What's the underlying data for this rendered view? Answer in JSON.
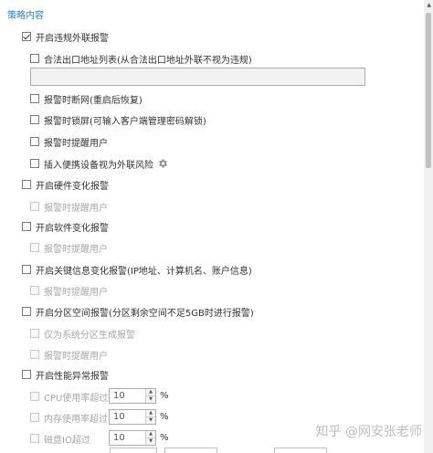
{
  "section": {
    "title": "策略内容"
  },
  "items": [
    {
      "key": "violation_alert",
      "label": "开启违规外联报警",
      "checked": true,
      "disabled": false
    },
    {
      "key": "legal_exit",
      "label": "合法出口地址列表(从合法出口地址外联不视为违规)",
      "checked": false,
      "disabled": false
    },
    {
      "key": "disconnect",
      "label": "报警时断网(重启后恢复)",
      "checked": false,
      "disabled": false
    },
    {
      "key": "lockscreen",
      "label": "报警时锁屏(可输入客户端管理密码解锁)",
      "checked": false,
      "disabled": false
    },
    {
      "key": "remind_user",
      "label": "报警时提醒用户",
      "checked": false,
      "disabled": false
    },
    {
      "key": "portable",
      "label": "插入便携设备视为外联风险",
      "checked": false,
      "disabled": false
    },
    {
      "key": "hardware",
      "label": "开启硬件变化报警",
      "checked": false,
      "disabled": false
    },
    {
      "key": "hardware_remind",
      "label": "报警时提醒用户",
      "checked": false,
      "disabled": true
    },
    {
      "key": "software",
      "label": "开启软件变化报警",
      "checked": false,
      "disabled": false
    },
    {
      "key": "software_remind",
      "label": "报警时提醒用户",
      "checked": false,
      "disabled": true
    },
    {
      "key": "keyinfo",
      "label": "开启关键信息变化报警(IP地址、计算机名、账户信息)",
      "checked": false,
      "disabled": false
    },
    {
      "key": "keyinfo_remind",
      "label": "报警时提醒用户",
      "checked": false,
      "disabled": true
    },
    {
      "key": "partition",
      "label": "开启分区空间报警(分区剩余空间不足5GB时进行报警)",
      "checked": false,
      "disabled": false
    },
    {
      "key": "partition_system",
      "label": "仅为系统分区生成报警",
      "checked": false,
      "disabled": true
    },
    {
      "key": "partition_remind",
      "label": "报警时提醒用户",
      "checked": false,
      "disabled": true
    },
    {
      "key": "performance",
      "label": "开启性能异常报警",
      "checked": false,
      "disabled": false
    },
    {
      "key": "cpu",
      "label": "CPU使用率超过",
      "checked": false,
      "disabled": true
    },
    {
      "key": "mem",
      "label": "内存使用率超过",
      "checked": false,
      "disabled": true
    },
    {
      "key": "disk_io",
      "label": "磁盘IO超过",
      "checked": false,
      "disabled": true
    }
  ],
  "legal_exit_input": {
    "value": ""
  },
  "spinners": {
    "cpu": {
      "value": "10",
      "unit": "%"
    },
    "mem": {
      "value": "10",
      "unit": "%"
    },
    "disk_io": {
      "value": "10",
      "unit": "%"
    }
  },
  "icons": {
    "settings": "gear-icon",
    "scroll_up": "arrow-up-icon"
  },
  "watermark": "知乎 @网安张老师",
  "colors": {
    "section_title": "#2a7fd4",
    "disabled_text": "#a8a8a8"
  }
}
